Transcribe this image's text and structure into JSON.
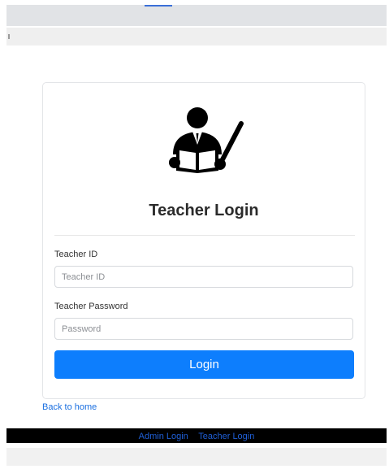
{
  "login_card": {
    "title": "Teacher Login",
    "id_label": "Teacher ID",
    "id_placeholder": "Teacher ID",
    "id_value": "",
    "password_label": "Teacher Password",
    "password_placeholder": "Password",
    "password_value": "",
    "submit_label": "Login",
    "logo_icon": "teacher-icon"
  },
  "back_link": "Back to home",
  "footer": {
    "links": [
      "Admin Login",
      "Teacher Login"
    ]
  },
  "colors": {
    "primary": "#0d7efd",
    "link": "#1a6fe0",
    "footer_bg": "#000000"
  }
}
